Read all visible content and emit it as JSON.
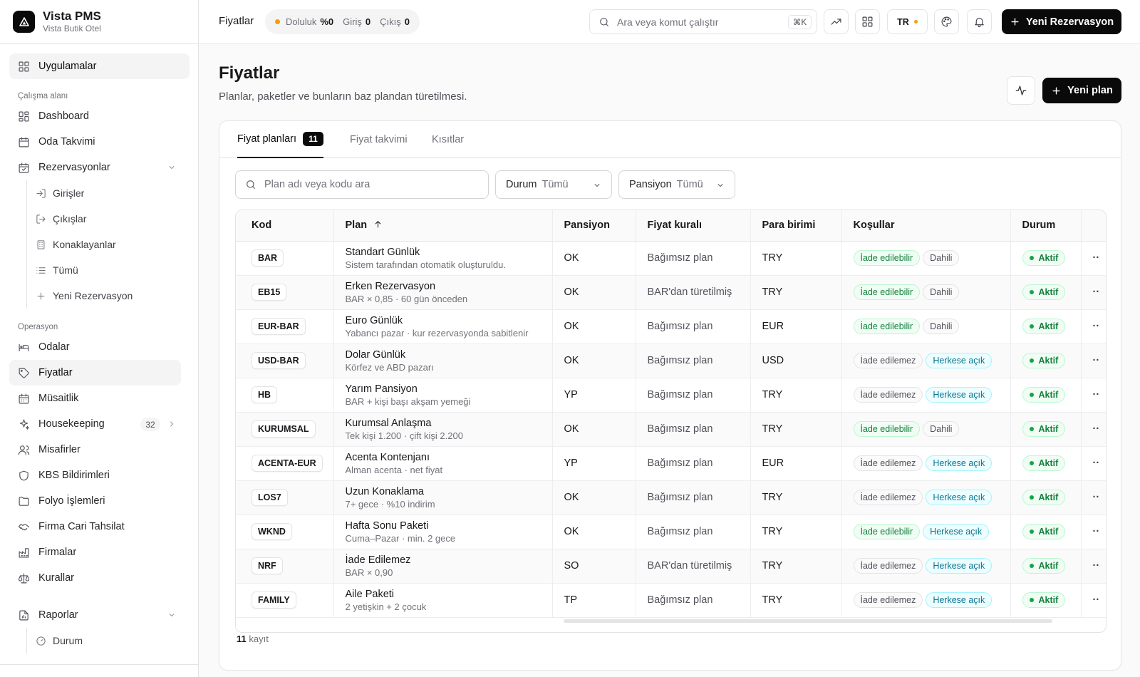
{
  "brand": {
    "name": "Vista PMS",
    "subtitle": "Vista Butik Otel"
  },
  "sidebar": {
    "apps_label": "Uygulamalar",
    "workspace_label": "Çalışma alanı",
    "workspace": {
      "dashboard": "Dashboard",
      "room_calendar": "Oda Takvimi",
      "reservations": "Rezervasyonlar"
    },
    "reservations_sub": {
      "checkins": "Girişler",
      "checkouts": "Çıkışlar",
      "inhouse": "Konaklayanlar",
      "all": "Tümü",
      "new": "Yeni Rezervasyon"
    },
    "operations_label": "Operasyon",
    "operations": {
      "rooms": "Odalar",
      "rates": "Fiyatlar",
      "availability": "Müsaitlik",
      "housekeeping": "Housekeeping",
      "housekeeping_badge": "32",
      "guests": "Misafirler",
      "kbs": "KBS Bildirimleri",
      "folio": "Folyo İşlemleri",
      "company_ar": "Firma Cari Tahsilat",
      "companies": "Firmalar",
      "rules": "Kurallar"
    },
    "reports": "Raporlar",
    "reports_sub": {
      "status": "Durum"
    }
  },
  "topbar": {
    "title": "Fiyatlar",
    "occupancy_label": "Doluluk",
    "occupancy_value": "%0",
    "arrivals_label": "Giriş",
    "arrivals_value": "0",
    "departures_label": "Çıkış",
    "departures_value": "0",
    "search_placeholder": "Ara veya komut çalıştır",
    "search_shortcut": "⌘K",
    "lang": "TR",
    "new_reservation": "Yeni Rezervasyon"
  },
  "page": {
    "title": "Fiyatlar",
    "subtitle": "Planlar, paketler ve bunların baz plandan türetilmesi.",
    "new_plan": "Yeni plan"
  },
  "tabs": {
    "plans": "Fiyat planları",
    "plans_count": "11",
    "calendar": "Fiyat takvimi",
    "restrictions": "Kısıtlar"
  },
  "filters": {
    "search_placeholder": "Plan adı veya kodu ara",
    "status_label": "Durum",
    "status_value": "Tümü",
    "board_label": "Pansiyon",
    "board_value": "Tümü"
  },
  "table": {
    "headers": {
      "code": "Kod",
      "plan": "Plan",
      "board": "Pansiyon",
      "rule": "Fiyat kuralı",
      "currency": "Para birimi",
      "conditions": "Koşullar",
      "status": "Durum"
    },
    "rows": [
      {
        "code": "BAR",
        "name": "Standart Günlük",
        "desc": "Sistem tarafından otomatik oluşturuldu.",
        "board": "OK",
        "rule": "Bağımsız plan",
        "currency": "TRY",
        "refund": "İade edilebilir",
        "refund_type": "green",
        "visibility": "Dahili",
        "visibility_type": "gray",
        "status": "Aktif"
      },
      {
        "code": "EB15",
        "name": "Erken Rezervasyon",
        "desc": "BAR × 0,85 · 60 gün önceden",
        "board": "OK",
        "rule": "BAR'dan türetilmiş",
        "currency": "TRY",
        "refund": "İade edilebilir",
        "refund_type": "green",
        "visibility": "Dahili",
        "visibility_type": "gray",
        "status": "Aktif"
      },
      {
        "code": "EUR-BAR",
        "name": "Euro Günlük",
        "desc": "Yabancı pazar · kur rezervasyonda sabitlenir",
        "board": "OK",
        "rule": "Bağımsız plan",
        "currency": "EUR",
        "refund": "İade edilebilir",
        "refund_type": "green",
        "visibility": "Dahili",
        "visibility_type": "gray",
        "status": "Aktif"
      },
      {
        "code": "USD-BAR",
        "name": "Dolar Günlük",
        "desc": "Körfez ve ABD pazarı",
        "board": "OK",
        "rule": "Bağımsız plan",
        "currency": "USD",
        "refund": "İade edilemez",
        "refund_type": "gray",
        "visibility": "Herkese açık",
        "visibility_type": "blue",
        "status": "Aktif"
      },
      {
        "code": "HB",
        "name": "Yarım Pansiyon",
        "desc": "BAR + kişi başı akşam yemeği",
        "board": "YP",
        "rule": "Bağımsız plan",
        "currency": "TRY",
        "refund": "İade edilemez",
        "refund_type": "gray",
        "visibility": "Herkese açık",
        "visibility_type": "blue",
        "status": "Aktif"
      },
      {
        "code": "KURUMSAL",
        "name": "Kurumsal Anlaşma",
        "desc": "Tek kişi 1.200 · çift kişi 2.200",
        "board": "OK",
        "rule": "Bağımsız plan",
        "currency": "TRY",
        "refund": "İade edilebilir",
        "refund_type": "green",
        "visibility": "Dahili",
        "visibility_type": "gray",
        "status": "Aktif"
      },
      {
        "code": "ACENTA-EUR",
        "name": "Acenta Kontenjanı",
        "desc": "Alman acenta · net fiyat",
        "board": "YP",
        "rule": "Bağımsız plan",
        "currency": "EUR",
        "refund": "İade edilemez",
        "refund_type": "gray",
        "visibility": "Herkese açık",
        "visibility_type": "blue",
        "status": "Aktif"
      },
      {
        "code": "LOS7",
        "name": "Uzun Konaklama",
        "desc": "7+ gece · %10 indirim",
        "board": "OK",
        "rule": "Bağımsız plan",
        "currency": "TRY",
        "refund": "İade edilemez",
        "refund_type": "gray",
        "visibility": "Herkese açık",
        "visibility_type": "blue",
        "status": "Aktif"
      },
      {
        "code": "WKND",
        "name": "Hafta Sonu Paketi",
        "desc": "Cuma–Pazar · min. 2 gece",
        "board": "OK",
        "rule": "Bağımsız plan",
        "currency": "TRY",
        "refund": "İade edilebilir",
        "refund_type": "green",
        "visibility": "Herkese açık",
        "visibility_type": "blue",
        "status": "Aktif"
      },
      {
        "code": "NRF",
        "name": "İade Edilemez",
        "desc": "BAR × 0,90",
        "board": "SO",
        "rule": "BAR'dan türetilmiş",
        "currency": "TRY",
        "refund": "İade edilemez",
        "refund_type": "gray",
        "visibility": "Herkese açık",
        "visibility_type": "blue",
        "status": "Aktif"
      },
      {
        "code": "FAMILY",
        "name": "Aile Paketi",
        "desc": "2 yetişkin + 2 çocuk",
        "board": "TP",
        "rule": "Bağımsız plan",
        "currency": "TRY",
        "refund": "İade edilemez",
        "refund_type": "gray",
        "visibility": "Herkese açık",
        "visibility_type": "blue",
        "status": "Aktif"
      }
    ],
    "row_action": "··"
  },
  "footer": {
    "count": "11",
    "count_label": "kayıt"
  },
  "colors": {
    "primary": "#0a0a0a",
    "accent_amber": "#f59e0b",
    "success": "#15803d",
    "info": "#0e7490"
  }
}
